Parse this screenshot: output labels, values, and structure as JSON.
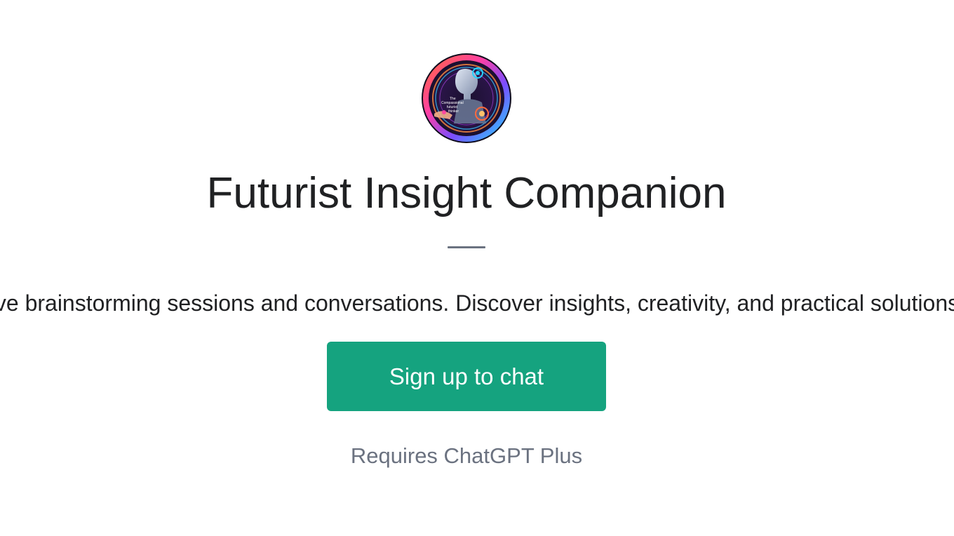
{
  "gpt": {
    "avatar_icon": "futurist-avatar-icon",
    "avatar_text": [
      "The",
      "Compassional",
      "futurist",
      "thinker"
    ],
    "title": "Futurist Insight Companion",
    "description": "ve brainstorming sessions and conversations. Discover insights, creativity, and practical solutions",
    "signup_label": "Sign up to chat",
    "requirement": "Requires ChatGPT Plus"
  },
  "colors": {
    "accent": "#15a37f",
    "title_text": "#202123",
    "muted_text": "#6b7280",
    "background": "#ffffff"
  }
}
